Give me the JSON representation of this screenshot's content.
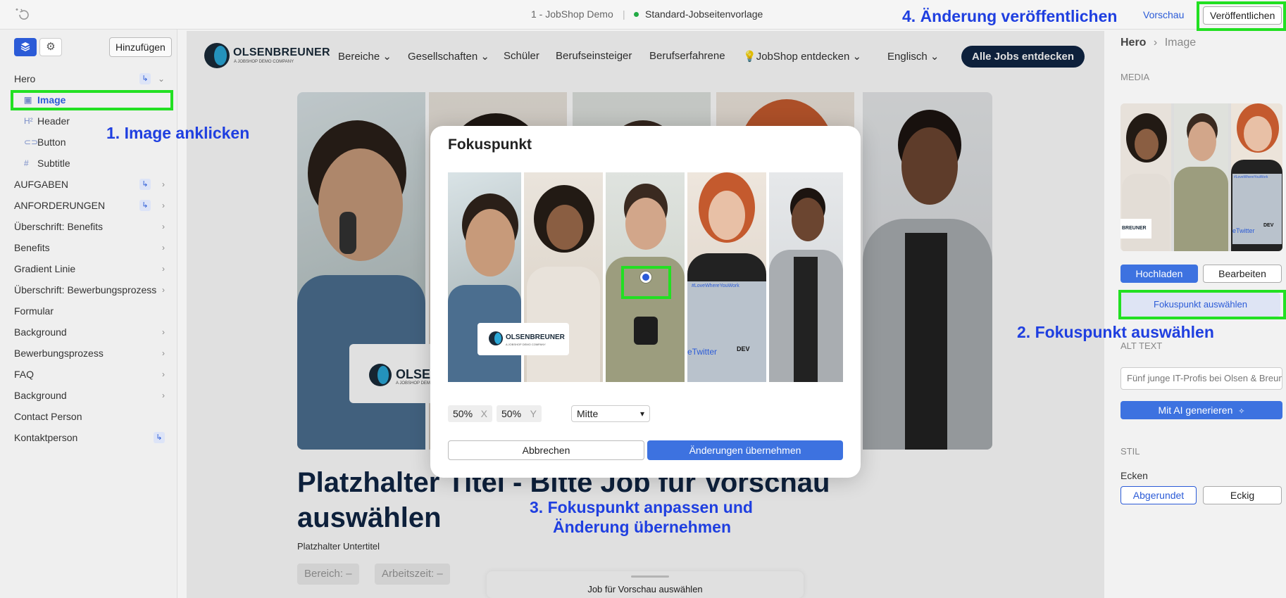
{
  "topbar": {
    "project": "1 - JobShop Demo",
    "separator": "|",
    "template": "Standard-Jobseitenvorlage",
    "preview": "Vorschau",
    "publish": "Veröffentlichen"
  },
  "annotations": {
    "step1": "1. Image anklicken",
    "step2": "2. Fokuspunkt auswählen",
    "step3_line1": "3. Fokuspunkt anpassen und",
    "step3_line2": "Änderung übernehmen",
    "step4": "4. Änderung veröffentlichen"
  },
  "sidebar": {
    "add_label": "Hinzufügen",
    "items": [
      {
        "label": "Hero"
      },
      {
        "label": "Image"
      },
      {
        "label": "Header"
      },
      {
        "label": "Button"
      },
      {
        "label": "Subtitle"
      },
      {
        "label": "AUFGABEN"
      },
      {
        "label": "ANFORDERUNGEN"
      },
      {
        "label": "Überschrift: Benefits"
      },
      {
        "label": "Benefits"
      },
      {
        "label": "Gradient Linie"
      },
      {
        "label": "Überschrift: Bewerbungsprozess"
      },
      {
        "label": "Formular"
      },
      {
        "label": "Background"
      },
      {
        "label": "Bewerbungsprozess"
      },
      {
        "label": "FAQ"
      },
      {
        "label": "Background"
      },
      {
        "label": "Contact Person"
      },
      {
        "label": "Kontaktperson"
      }
    ]
  },
  "site": {
    "logo_name": "OLSENBREUNER",
    "logo_sub": "A JOBSHOP DEMO COMPANY",
    "nav": [
      "Bereiche",
      "Gesellschaften",
      "Schüler",
      "Berufseinsteiger",
      "Berufserfahrene",
      "JobShop entdecken",
      "Englisch"
    ],
    "cta": "Alle Jobs entdecken",
    "hero_logo": "OLSEN",
    "hero_logo_sub": "A JOBSHOP DEMO",
    "title": "Platzhalter Titel - Bitte Job für Vorschau auswählen",
    "subtitle": "Platzhalter Untertitel",
    "chip1": "Bereich: –",
    "chip2": "Arbeitszeit: –",
    "bottom_card": "Job für Vorschau auswählen"
  },
  "right_panel": {
    "crumb_parent": "Hero",
    "crumb_sep": "›",
    "crumb_current": "Image",
    "media_heading": "MEDIA",
    "upload": "Hochladen",
    "edit": "Bearbeiten",
    "focus_button": "Fokuspunkt auswählen",
    "alt_heading": "ALT TEXT",
    "alt_value": "Fünf junge IT-Profis bei Olsen & Breuner",
    "ai_button": "Mit AI generieren",
    "style_heading": "STIL",
    "corners_label": "Ecken",
    "rounded": "Abgerundet",
    "square": "Eckig",
    "thumb_logo": "BREUNER",
    "thumb_tag": "#LoveWhereYouWork",
    "thumb_text": "eTwitter",
    "thumb_dev": "DEV"
  },
  "modal": {
    "title": "Fokuspunkt",
    "x_value": "50%",
    "x_axis": "X",
    "y_value": "50%",
    "y_axis": "Y",
    "position": "Mitte",
    "cancel": "Abbrechen",
    "apply": "Änderungen übernehmen",
    "img_logo": "OLSENBREUNER",
    "img_logo_sub": "A JOBSHOP DEMO COMPANY",
    "img_tag": "#LoveWhereYouWork",
    "img_twitter": "eTwitter",
    "img_dev": "DEV"
  },
  "colors": {
    "accent": "#2b5bd7",
    "highlight": "#22e022",
    "annotation": "#1f3fe0",
    "brand_dark": "#0f2544"
  }
}
